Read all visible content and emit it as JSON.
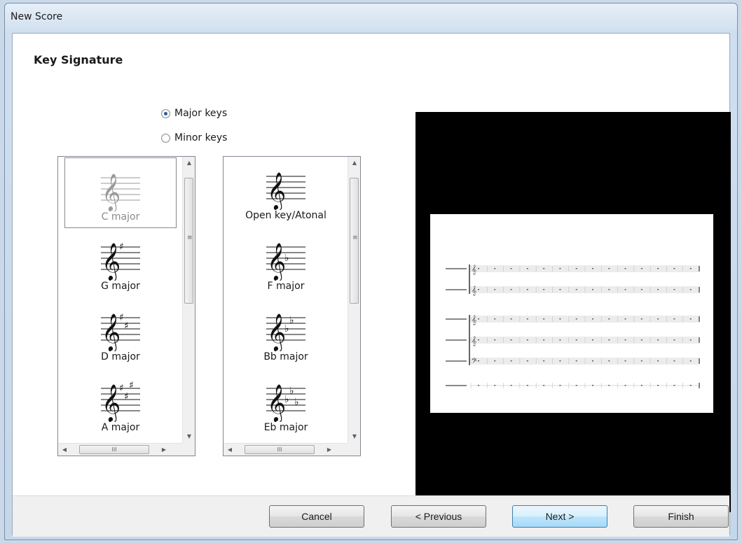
{
  "window": {
    "title": "New Score"
  },
  "header": {
    "heading": "Key Signature"
  },
  "mode": {
    "major_label": "Major keys",
    "minor_label": "Minor keys",
    "selected": "major"
  },
  "sharp_keys": [
    {
      "label": "C major",
      "accidentals": 0,
      "type": "none",
      "selected": true
    },
    {
      "label": "G major",
      "accidentals": 1,
      "type": "sharp"
    },
    {
      "label": "D major",
      "accidentals": 2,
      "type": "sharp"
    },
    {
      "label": "A major",
      "accidentals": 3,
      "type": "sharp"
    }
  ],
  "flat_keys": [
    {
      "label": "Open key/Atonal",
      "accidentals": 0,
      "type": "none"
    },
    {
      "label": "F major",
      "accidentals": 1,
      "type": "flat"
    },
    {
      "label": "Bb major",
      "accidentals": 2,
      "type": "flat"
    },
    {
      "label": "Eb major",
      "accidentals": 3,
      "type": "flat"
    }
  ],
  "scroll_glyphs": {
    "up": "▲",
    "down": "▼",
    "left": "◀",
    "right": "▶",
    "grip": "III"
  },
  "buttons": {
    "cancel": "Cancel",
    "previous": "< Previous",
    "next": "Next >",
    "finish": "Finish"
  },
  "preview": {
    "staves": [
      {
        "clef": "treble"
      },
      {
        "clef": "treble"
      },
      {
        "clef": "treble"
      },
      {
        "clef": "treble"
      },
      {
        "clef": "bass"
      },
      {
        "clef": "percussion"
      }
    ]
  }
}
